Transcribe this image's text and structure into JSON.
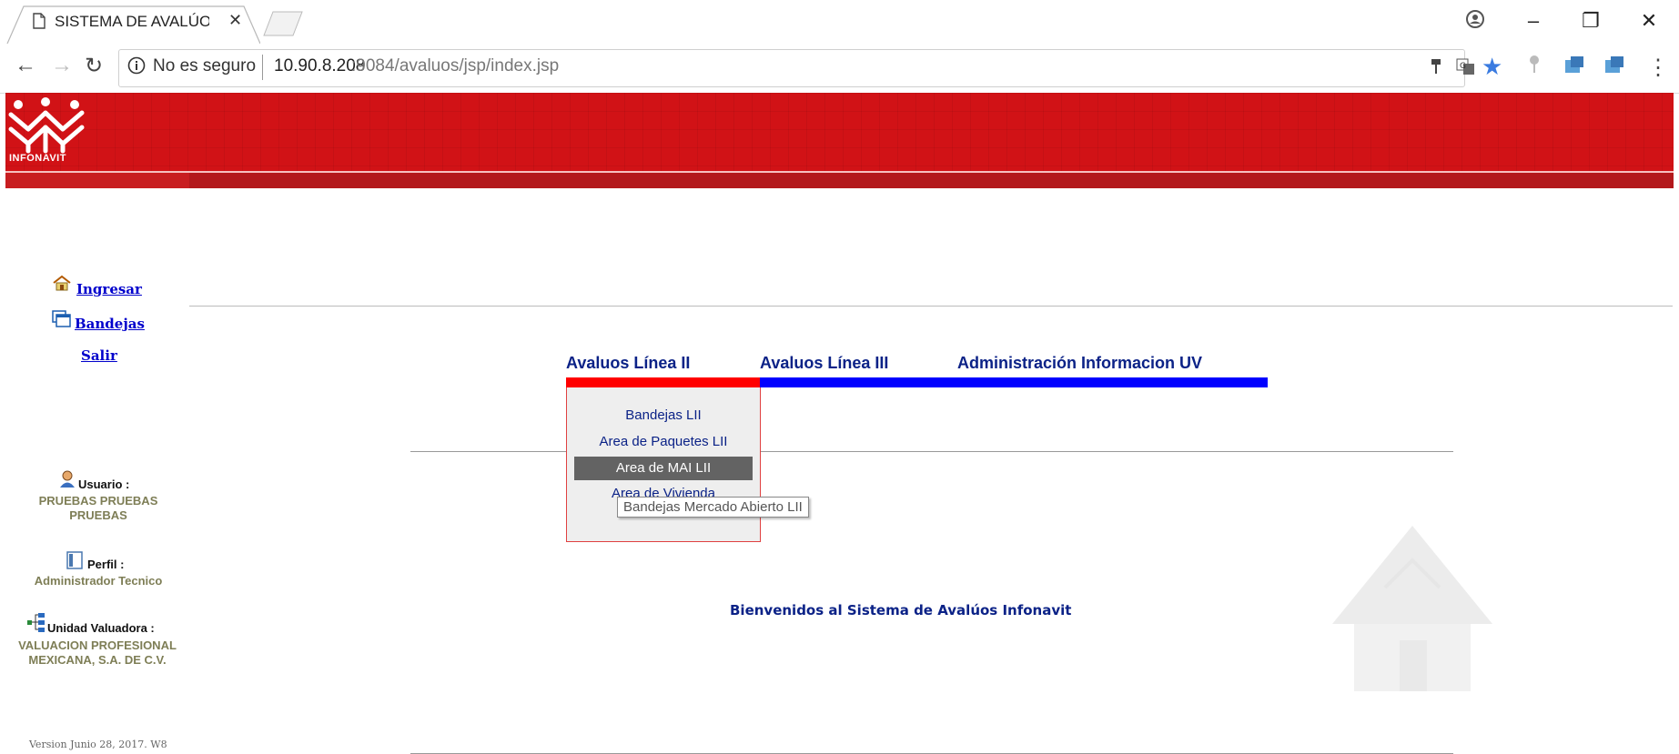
{
  "browser": {
    "tab_title": "SISTEMA DE AVALÚOS IN",
    "security_label": "No es seguro",
    "url_host": "10.90.8.208",
    "url_rest": ":9084/avaluos/jsp/index.jsp"
  },
  "banner": {
    "logo_text": "INFONAVIT"
  },
  "sidebar": {
    "links": [
      {
        "label": "Ingresar",
        "icon": "home-icon"
      },
      {
        "label": "Bandejas",
        "icon": "trays-icon"
      },
      {
        "label": "Salir"
      }
    ],
    "user_label": "Usuario :",
    "user_value": "PRUEBAS PRUEBAS PRUEBAS",
    "perfil_label": "Perfil :",
    "perfil_value": "Administrador Tecnico",
    "unidad_label": "Unidad Valuadora :",
    "unidad_value": "VALUACION PROFESIONAL MEXICANA, S.A. DE C.V.",
    "version": "Version Junio 28, 2017. W8"
  },
  "main": {
    "tabs": [
      {
        "label": "Avaluos Línea II",
        "color": "#ff0000"
      },
      {
        "label": "Avaluos Línea III",
        "color": "#0000ff"
      },
      {
        "label": "Administración Informacion UV",
        "color": "#0000ff"
      }
    ],
    "dropdown_items": [
      "Bandejas LII",
      "Area de Paquetes LII",
      "Area de MAI LII",
      "Area de Vivienda Recuperada"
    ],
    "tooltip": "Bandejas Mercado Abierto LII",
    "welcome": "Bienvenidos al Sistema de Avalúos Infonavit"
  },
  "colors": {
    "banner_red": "#d11216",
    "link_blue": "#0000cc",
    "heading_navy": "#0b2287",
    "info_olive": "#7e7e56",
    "highlight_gray": "#636363"
  }
}
